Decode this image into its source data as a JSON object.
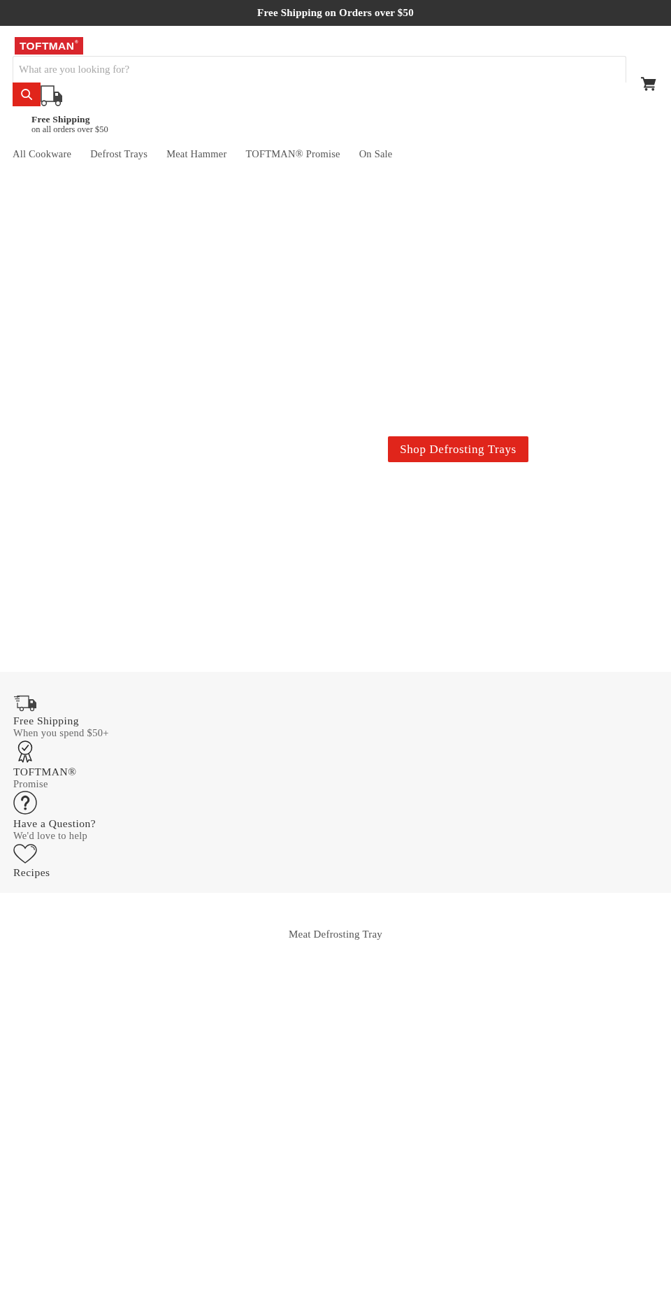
{
  "announcement_bar": {
    "text": "Free Shipping on Orders over $50"
  },
  "header": {
    "logo": {
      "text": "TOFTMAN$^{®}$"
    },
    "search": {
      "placeholder": "What are you looking for?"
    },
    "shipping_promo": {
      "title": "Free Shipping",
      "subtitle": "on all orders over $50"
    }
  },
  "nav": {
    "items": [
      {
        "label": "All Cookware"
      },
      {
        "label": "Defrost Trays"
      },
      {
        "label": "Meat Hammer"
      },
      {
        "label": "TOFTMAN® Promise"
      },
      {
        "label": "On Sale"
      }
    ]
  },
  "hero": {
    "button": "Shop Defrosting Trays"
  },
  "features": [
    {
      "kind": "truck",
      "title": "Free Shipping",
      "subtitle": "When you spend $50+"
    },
    {
      "kind": "ribbon",
      "title": "TOFTMAN®",
      "subtitle": "Promise"
    },
    {
      "kind": "question",
      "title": "Have a Question?",
      "subtitle": "We'd love to help"
    },
    {
      "kind": "heart",
      "title": "Recipes"
    }
  ],
  "product_section": {
    "title": "Meat Defrosting Tray"
  }
}
